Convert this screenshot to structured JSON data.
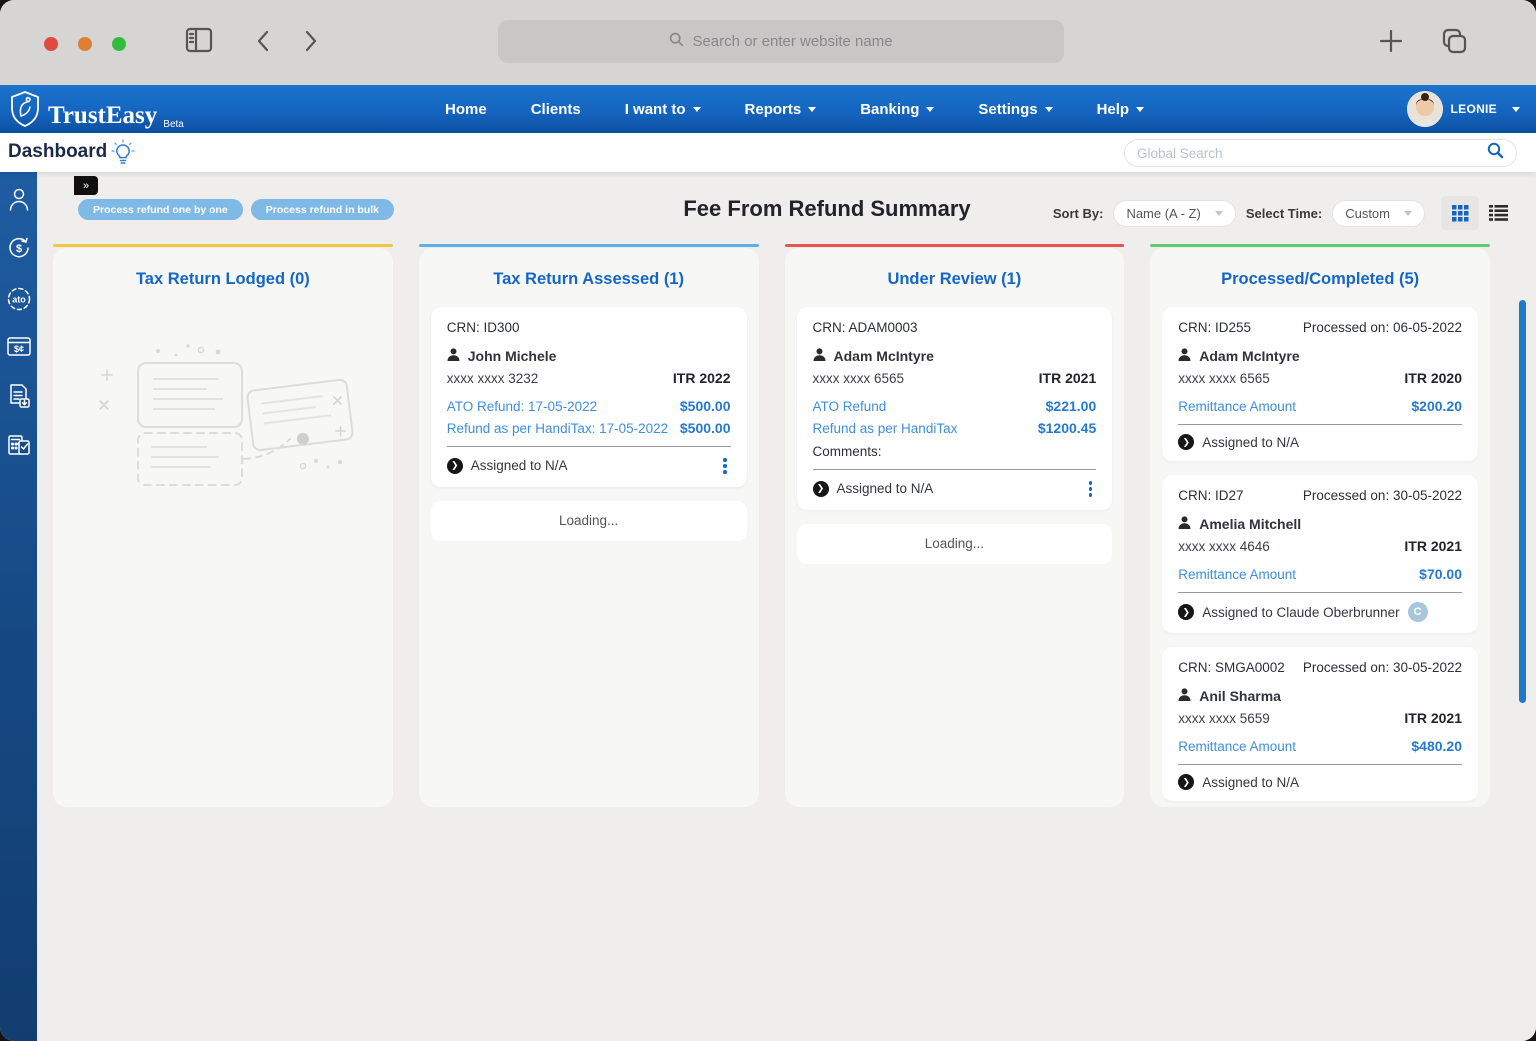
{
  "browser": {
    "search_placeholder": "Search or enter website name"
  },
  "navbar": {
    "brand": "TrustEasy",
    "brand_suffix": "Beta",
    "user": "LEONIE",
    "items": [
      {
        "label": "Home"
      },
      {
        "label": "Clients"
      },
      {
        "label": "I want to"
      },
      {
        "label": "Reports"
      },
      {
        "label": "Banking"
      },
      {
        "label": "Settings"
      },
      {
        "label": "Help"
      }
    ]
  },
  "page": {
    "title": "Dashboard"
  },
  "global_search": {
    "placeholder": "Global Search"
  },
  "board": {
    "title": "Fee From Refund Summary",
    "actions": [
      {
        "label": "Process refund one by one"
      },
      {
        "label": "Process refund in bulk"
      }
    ],
    "sort_by": {
      "label": "Sort By:",
      "value": "Name (A - Z)"
    },
    "select_time": {
      "label": "Select Time:",
      "value": "Custom"
    }
  },
  "columns": [
    {
      "title": "Tax Return Lodged (0)",
      "accent": "#f6c540"
    },
    {
      "title": "Tax Return Assessed (1)",
      "accent": "#5fb0ea",
      "loading": "Loading...",
      "cards": [
        {
          "crn": "CRN: ID300",
          "name": "John Michele",
          "masked": "xxxx xxxx 3232",
          "itr": "ITR 2022",
          "lines": [
            {
              "label": "ATO Refund: 17-05-2022",
              "amount": "$500.00"
            },
            {
              "label": "Refund as per HandiTax: 17-05-2022",
              "amount": "$500.00"
            }
          ],
          "assigned": "Assigned to N/A"
        }
      ]
    },
    {
      "title": "Under Review (1)",
      "accent": "#e6544b",
      "loading": "Loading...",
      "cards": [
        {
          "crn": "CRN: ADAM0003",
          "name": "Adam McIntyre",
          "masked": "xxxx xxxx 6565",
          "itr": "ITR 2021",
          "lines": [
            {
              "label": "ATO Refund",
              "amount": "$221.00"
            },
            {
              "label": "Refund as per HandiTax",
              "amount": "$1200.45"
            }
          ],
          "comments": "Comments:",
          "assigned": "Assigned to N/A"
        }
      ]
    },
    {
      "title": "Processed/Completed (5)",
      "accent": "#5ecd72",
      "cards": [
        {
          "crn": "CRN: ID255",
          "processed": "Processed on: 06-05-2022",
          "name": "Adam McIntyre",
          "masked": "xxxx xxxx 6565",
          "itr": "ITR 2020",
          "lines": [
            {
              "label": "Remittance Amount",
              "amount": "$200.20"
            }
          ],
          "assigned": "Assigned to N/A"
        },
        {
          "crn": "CRN: ID27",
          "processed": "Processed on: 30-05-2022",
          "name": "Amelia Mitchell",
          "masked": "xxxx xxxx 4646",
          "itr": "ITR 2021",
          "lines": [
            {
              "label": "Remittance Amount",
              "amount": "$70.00"
            }
          ],
          "assigned": "Assigned to Claude Oberbrunner",
          "assignee_badge": "C"
        },
        {
          "crn": "CRN: SMGA0002",
          "processed": "Processed on: 30-05-2022",
          "name": "Anil Sharma",
          "masked": "xxxx xxxx 5659",
          "itr": "ITR 2021",
          "lines": [
            {
              "label": "Remittance Amount",
              "amount": "$480.20"
            }
          ],
          "assigned": "Assigned to N/A"
        }
      ]
    }
  ]
}
